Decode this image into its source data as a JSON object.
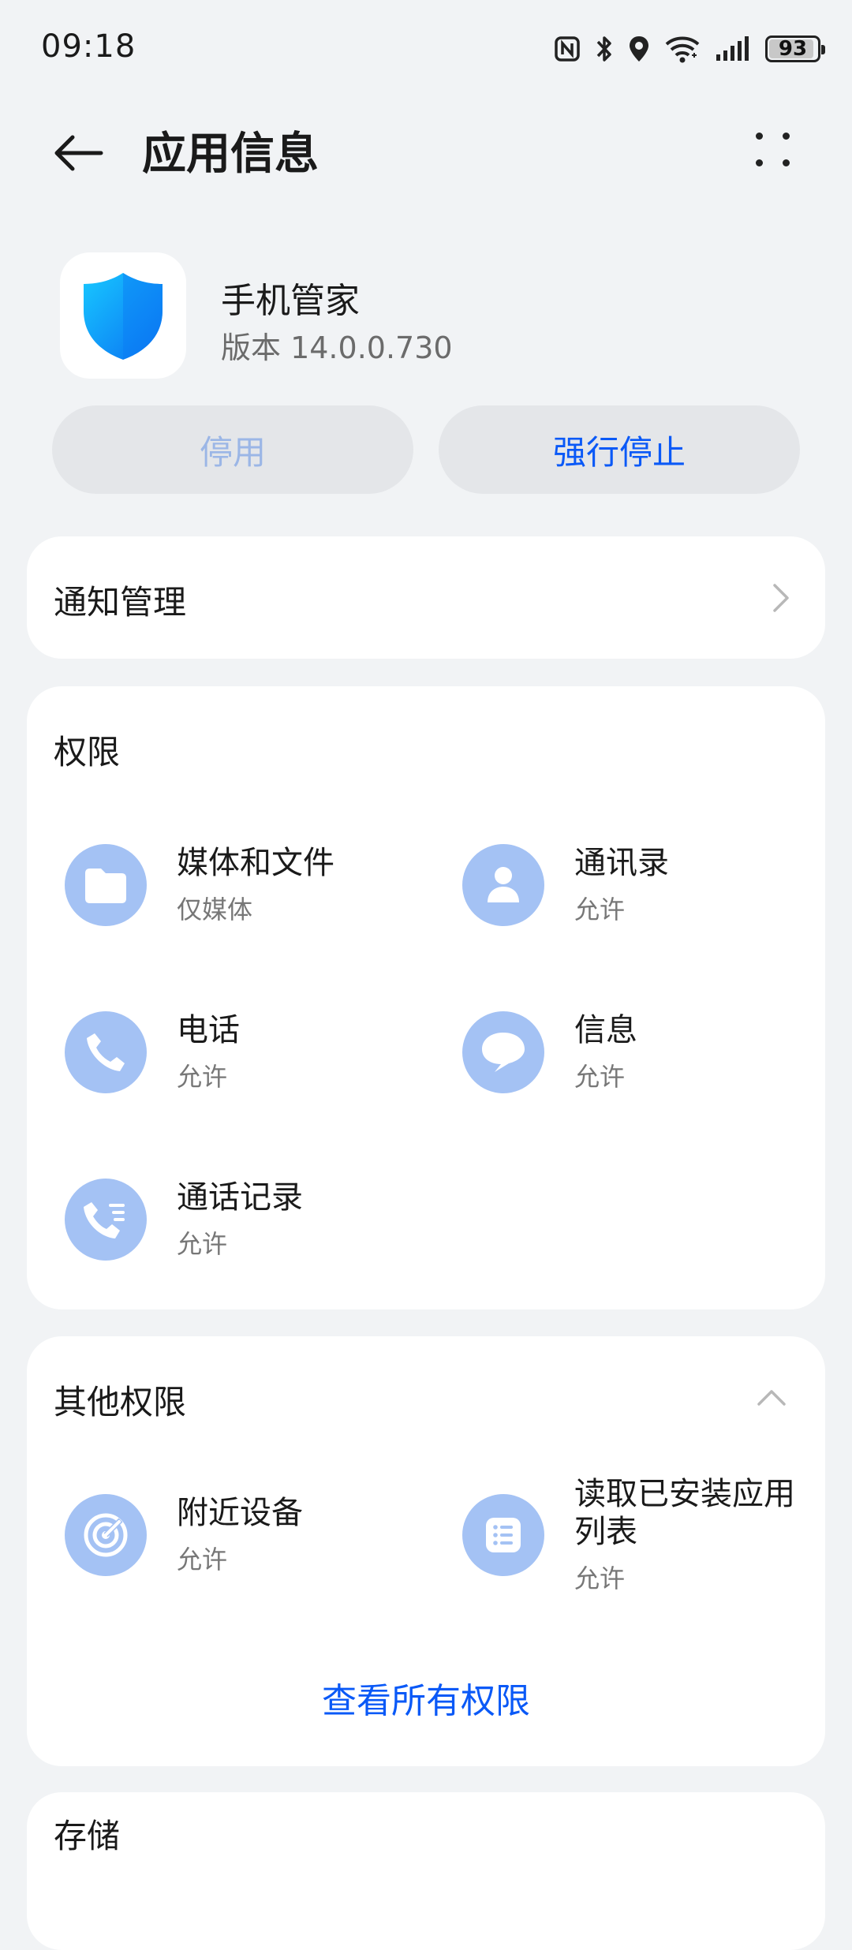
{
  "status_bar": {
    "time": "09:18",
    "battery": "93",
    "battery_level": 0.93
  },
  "header": {
    "title": "应用信息"
  },
  "app": {
    "name": "手机管家",
    "version": "版本 14.0.0.730"
  },
  "actions": {
    "disable_label": "停用",
    "force_stop_label": "强行停止"
  },
  "notification": {
    "label": "通知管理"
  },
  "permissions": {
    "title": "权限",
    "items": [
      {
        "name": "媒体和文件",
        "status": "仅媒体",
        "icon": "folder-icon"
      },
      {
        "name": "通讯录",
        "status": "允许",
        "icon": "contacts-icon"
      },
      {
        "name": "电话",
        "status": "允许",
        "icon": "phone-icon"
      },
      {
        "name": "信息",
        "status": "允许",
        "icon": "message-icon"
      },
      {
        "name": "通话记录",
        "status": "允许",
        "icon": "call-log-icon"
      }
    ]
  },
  "other_permissions": {
    "title": "其他权限",
    "items": [
      {
        "name": "附近设备",
        "status": "允许",
        "icon": "nearby-devices-icon"
      },
      {
        "name": "读取已安装应用列表",
        "status": "允许",
        "icon": "app-list-icon"
      }
    ],
    "view_all": "查看所有权限"
  },
  "storage": {
    "title": "存储"
  },
  "colors": {
    "accent": "#0a59f7",
    "icon_bg": "#a4c2f4",
    "background": "#f1f3f5"
  }
}
